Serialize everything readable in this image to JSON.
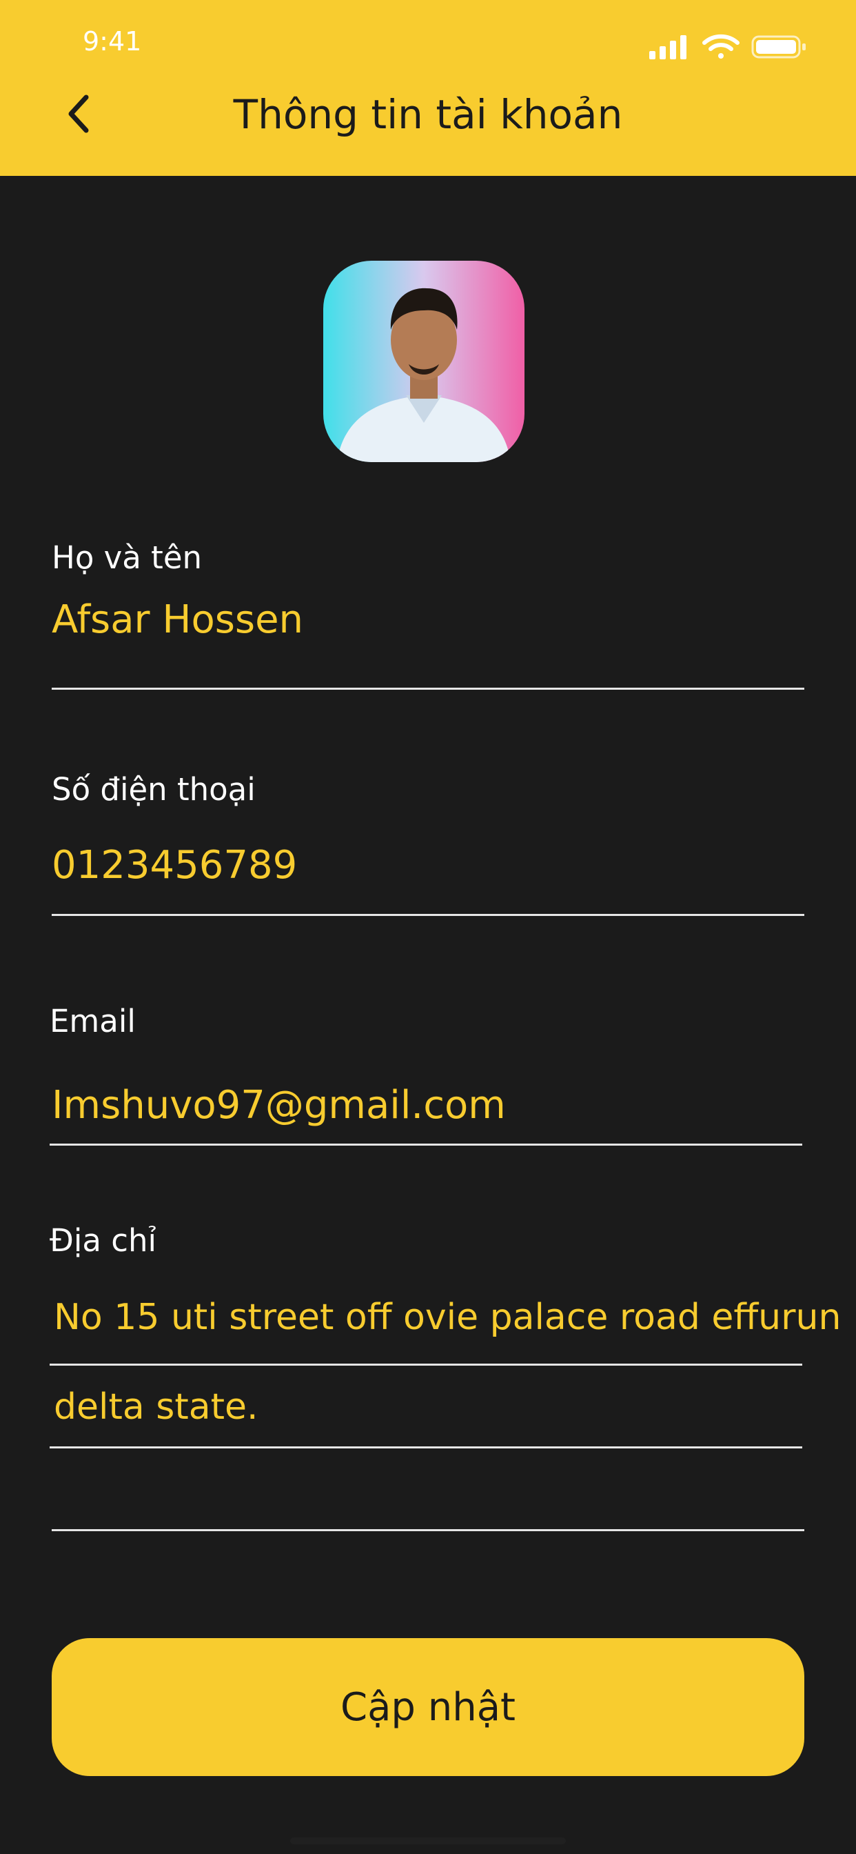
{
  "status_bar": {
    "time": "9:41"
  },
  "header": {
    "title": "Thông tin tài khoản"
  },
  "icons": {
    "back": "chevron-left-icon",
    "signal": "signal-icon",
    "wifi": "wifi-icon",
    "battery": "battery-icon"
  },
  "colors": {
    "accent": "#f8cc2f",
    "background": "#1b1b1b",
    "text": "#ffffff"
  },
  "form": {
    "name": {
      "label": "Họ và tên",
      "value": "Afsar Hossen"
    },
    "phone": {
      "label": "Số điện thoại",
      "value": "0123456789"
    },
    "email": {
      "label": "Email",
      "value": "Imshuvo97@gmail.com"
    },
    "address": {
      "label": "Địa chỉ",
      "lines": [
        "No 15 uti street off ovie palace road effurun",
        "delta state."
      ]
    }
  },
  "update_button": {
    "label": "Cập nhật"
  }
}
